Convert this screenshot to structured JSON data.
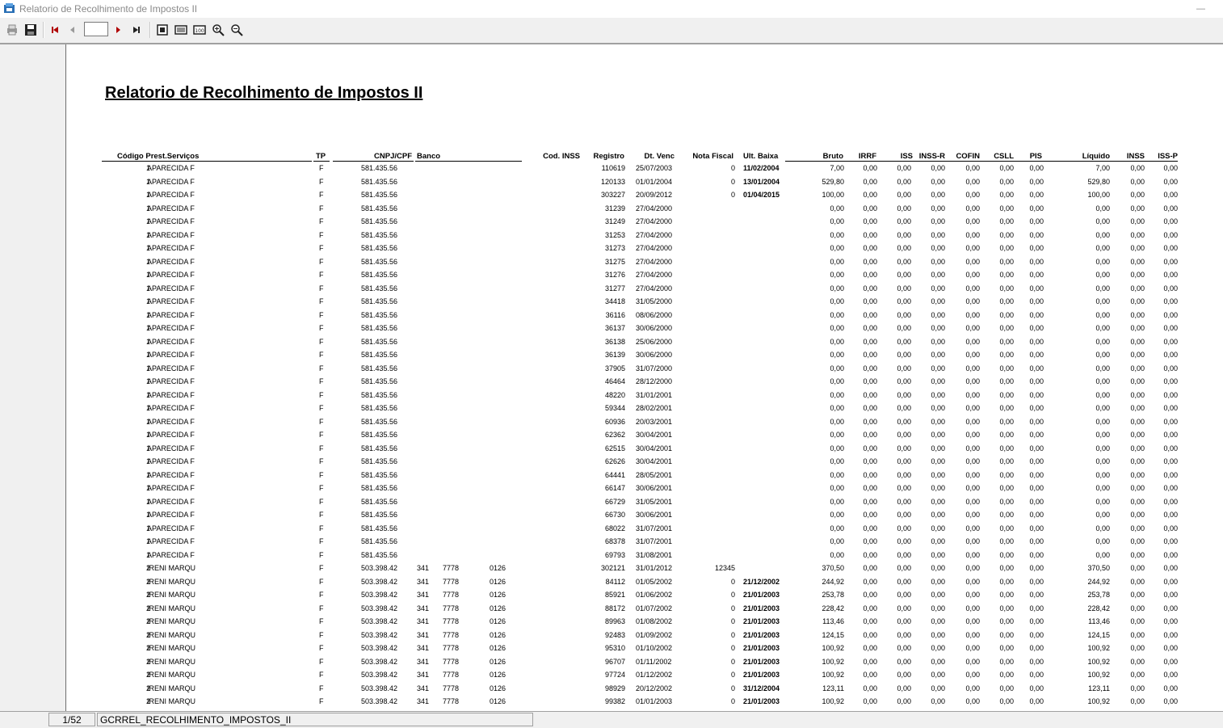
{
  "window": {
    "title": "Relatorio de Recolhimento de Impostos II",
    "minimize_glyph": "—"
  },
  "toolbar": {
    "buttons": [
      {
        "name": "print-icon"
      },
      {
        "name": "save-icon"
      },
      {
        "name": "first-page-icon"
      },
      {
        "name": "previous-page-icon"
      },
      {
        "name": "next-page-icon"
      },
      {
        "name": "last-page-icon"
      },
      {
        "name": "whole-page-icon"
      },
      {
        "name": "page-width-icon"
      },
      {
        "name": "zoom-100-icon"
      },
      {
        "name": "zoom-in-icon"
      },
      {
        "name": "zoom-out-icon"
      }
    ],
    "page_input": ""
  },
  "report": {
    "title": "Relatorio de Recolhimento de Impostos II",
    "headers": {
      "codigo": "Código Prest.Serviços",
      "tp": "TP",
      "cnpj": "CNPJ/CPF",
      "banco": "Banco",
      "cod_inss": "Cod. INSS",
      "registro": "Registro",
      "dt_venc": "Dt. Venc",
      "nota_fiscal": "Nota Fiscal",
      "ult_baixa": "Ult. Baixa",
      "bruto": "Bruto",
      "irrf": "IRRF",
      "iss": "ISS",
      "inss_r": "INSS-R",
      "cofin": "COFIN",
      "csll": "CSLL",
      "pis": "PIS",
      "liquido": "Líquido",
      "inss": "INSS",
      "iss_p": "ISS-P"
    },
    "rows": [
      {
        "cod": "1",
        "nome": "APARECIDA F",
        "tp": "F",
        "cnpj": "581.435.56",
        "banco": "",
        "ag": "",
        "conta": "",
        "registro": "110619",
        "dt_venc": "25/07/2003",
        "nf": "0",
        "ult_baixa": "11/02/2004",
        "bruto": "7,00",
        "liquido": "7,00"
      },
      {
        "cod": "1",
        "nome": "APARECIDA F",
        "tp": "F",
        "cnpj": "581.435.56",
        "banco": "",
        "ag": "",
        "conta": "",
        "registro": "120133",
        "dt_venc": "01/01/2004",
        "nf": "0",
        "ult_baixa": "13/01/2004",
        "bruto": "529,80",
        "liquido": "529,80"
      },
      {
        "cod": "1",
        "nome": "APARECIDA F",
        "tp": "F",
        "cnpj": "581.435.56",
        "banco": "",
        "ag": "",
        "conta": "",
        "registro": "303227",
        "dt_venc": "20/09/2012",
        "nf": "0",
        "ult_baixa": "01/04/2015",
        "bruto": "100,00",
        "liquido": "100,00"
      },
      {
        "cod": "1",
        "nome": "APARECIDA F",
        "tp": "F",
        "cnpj": "581.435.56",
        "banco": "",
        "ag": "",
        "conta": "",
        "registro": "31239",
        "dt_venc": "27/04/2000",
        "nf": "",
        "ult_baixa": "",
        "bruto": "0,00",
        "liquido": "0,00"
      },
      {
        "cod": "1",
        "nome": "APARECIDA F",
        "tp": "F",
        "cnpj": "581.435.56",
        "banco": "",
        "ag": "",
        "conta": "",
        "registro": "31249",
        "dt_venc": "27/04/2000",
        "nf": "",
        "ult_baixa": "",
        "bruto": "0,00",
        "liquido": "0,00"
      },
      {
        "cod": "1",
        "nome": "APARECIDA F",
        "tp": "F",
        "cnpj": "581.435.56",
        "banco": "",
        "ag": "",
        "conta": "",
        "registro": "31253",
        "dt_venc": "27/04/2000",
        "nf": "",
        "ult_baixa": "",
        "bruto": "0,00",
        "liquido": "0,00"
      },
      {
        "cod": "1",
        "nome": "APARECIDA F",
        "tp": "F",
        "cnpj": "581.435.56",
        "banco": "",
        "ag": "",
        "conta": "",
        "registro": "31273",
        "dt_venc": "27/04/2000",
        "nf": "",
        "ult_baixa": "",
        "bruto": "0,00",
        "liquido": "0,00"
      },
      {
        "cod": "1",
        "nome": "APARECIDA F",
        "tp": "F",
        "cnpj": "581.435.56",
        "banco": "",
        "ag": "",
        "conta": "",
        "registro": "31275",
        "dt_venc": "27/04/2000",
        "nf": "",
        "ult_baixa": "",
        "bruto": "0,00",
        "liquido": "0,00"
      },
      {
        "cod": "1",
        "nome": "APARECIDA F",
        "tp": "F",
        "cnpj": "581.435.56",
        "banco": "",
        "ag": "",
        "conta": "",
        "registro": "31276",
        "dt_venc": "27/04/2000",
        "nf": "",
        "ult_baixa": "",
        "bruto": "0,00",
        "liquido": "0,00"
      },
      {
        "cod": "1",
        "nome": "APARECIDA F",
        "tp": "F",
        "cnpj": "581.435.56",
        "banco": "",
        "ag": "",
        "conta": "",
        "registro": "31277",
        "dt_venc": "27/04/2000",
        "nf": "",
        "ult_baixa": "",
        "bruto": "0,00",
        "liquido": "0,00"
      },
      {
        "cod": "1",
        "nome": "APARECIDA F",
        "tp": "F",
        "cnpj": "581.435.56",
        "banco": "",
        "ag": "",
        "conta": "",
        "registro": "34418",
        "dt_venc": "31/05/2000",
        "nf": "",
        "ult_baixa": "",
        "bruto": "0,00",
        "liquido": "0,00"
      },
      {
        "cod": "1",
        "nome": "APARECIDA F",
        "tp": "F",
        "cnpj": "581.435.56",
        "banco": "",
        "ag": "",
        "conta": "",
        "registro": "36116",
        "dt_venc": "08/06/2000",
        "nf": "",
        "ult_baixa": "",
        "bruto": "0,00",
        "liquido": "0,00"
      },
      {
        "cod": "1",
        "nome": "APARECIDA F",
        "tp": "F",
        "cnpj": "581.435.56",
        "banco": "",
        "ag": "",
        "conta": "",
        "registro": "36137",
        "dt_venc": "30/06/2000",
        "nf": "",
        "ult_baixa": "",
        "bruto": "0,00",
        "liquido": "0,00"
      },
      {
        "cod": "1",
        "nome": "APARECIDA F",
        "tp": "F",
        "cnpj": "581.435.56",
        "banco": "",
        "ag": "",
        "conta": "",
        "registro": "36138",
        "dt_venc": "25/06/2000",
        "nf": "",
        "ult_baixa": "",
        "bruto": "0,00",
        "liquido": "0,00"
      },
      {
        "cod": "1",
        "nome": "APARECIDA F",
        "tp": "F",
        "cnpj": "581.435.56",
        "banco": "",
        "ag": "",
        "conta": "",
        "registro": "36139",
        "dt_venc": "30/06/2000",
        "nf": "",
        "ult_baixa": "",
        "bruto": "0,00",
        "liquido": "0,00"
      },
      {
        "cod": "1",
        "nome": "APARECIDA F",
        "tp": "F",
        "cnpj": "581.435.56",
        "banco": "",
        "ag": "",
        "conta": "",
        "registro": "37905",
        "dt_venc": "31/07/2000",
        "nf": "",
        "ult_baixa": "",
        "bruto": "0,00",
        "liquido": "0,00"
      },
      {
        "cod": "1",
        "nome": "APARECIDA F",
        "tp": "F",
        "cnpj": "581.435.56",
        "banco": "",
        "ag": "",
        "conta": "",
        "registro": "46464",
        "dt_venc": "28/12/2000",
        "nf": "",
        "ult_baixa": "",
        "bruto": "0,00",
        "liquido": "0,00"
      },
      {
        "cod": "1",
        "nome": "APARECIDA F",
        "tp": "F",
        "cnpj": "581.435.56",
        "banco": "",
        "ag": "",
        "conta": "",
        "registro": "48220",
        "dt_venc": "31/01/2001",
        "nf": "",
        "ult_baixa": "",
        "bruto": "0,00",
        "liquido": "0,00"
      },
      {
        "cod": "1",
        "nome": "APARECIDA F",
        "tp": "F",
        "cnpj": "581.435.56",
        "banco": "",
        "ag": "",
        "conta": "",
        "registro": "59344",
        "dt_venc": "28/02/2001",
        "nf": "",
        "ult_baixa": "",
        "bruto": "0,00",
        "liquido": "0,00"
      },
      {
        "cod": "1",
        "nome": "APARECIDA F",
        "tp": "F",
        "cnpj": "581.435.56",
        "banco": "",
        "ag": "",
        "conta": "",
        "registro": "60936",
        "dt_venc": "20/03/2001",
        "nf": "",
        "ult_baixa": "",
        "bruto": "0,00",
        "liquido": "0,00"
      },
      {
        "cod": "1",
        "nome": "APARECIDA F",
        "tp": "F",
        "cnpj": "581.435.56",
        "banco": "",
        "ag": "",
        "conta": "",
        "registro": "62362",
        "dt_venc": "30/04/2001",
        "nf": "",
        "ult_baixa": "",
        "bruto": "0,00",
        "liquido": "0,00"
      },
      {
        "cod": "1",
        "nome": "APARECIDA F",
        "tp": "F",
        "cnpj": "581.435.56",
        "banco": "",
        "ag": "",
        "conta": "",
        "registro": "62515",
        "dt_venc": "30/04/2001",
        "nf": "",
        "ult_baixa": "",
        "bruto": "0,00",
        "liquido": "0,00"
      },
      {
        "cod": "1",
        "nome": "APARECIDA F",
        "tp": "F",
        "cnpj": "581.435.56",
        "banco": "",
        "ag": "",
        "conta": "",
        "registro": "62626",
        "dt_venc": "30/04/2001",
        "nf": "",
        "ult_baixa": "",
        "bruto": "0,00",
        "liquido": "0,00"
      },
      {
        "cod": "1",
        "nome": "APARECIDA F",
        "tp": "F",
        "cnpj": "581.435.56",
        "banco": "",
        "ag": "",
        "conta": "",
        "registro": "64441",
        "dt_venc": "28/05/2001",
        "nf": "",
        "ult_baixa": "",
        "bruto": "0,00",
        "liquido": "0,00"
      },
      {
        "cod": "1",
        "nome": "APARECIDA F",
        "tp": "F",
        "cnpj": "581.435.56",
        "banco": "",
        "ag": "",
        "conta": "",
        "registro": "66147",
        "dt_venc": "30/06/2001",
        "nf": "",
        "ult_baixa": "",
        "bruto": "0,00",
        "liquido": "0,00"
      },
      {
        "cod": "1",
        "nome": "APARECIDA F",
        "tp": "F",
        "cnpj": "581.435.56",
        "banco": "",
        "ag": "",
        "conta": "",
        "registro": "66729",
        "dt_venc": "31/05/2001",
        "nf": "",
        "ult_baixa": "",
        "bruto": "0,00",
        "liquido": "0,00"
      },
      {
        "cod": "1",
        "nome": "APARECIDA F",
        "tp": "F",
        "cnpj": "581.435.56",
        "banco": "",
        "ag": "",
        "conta": "",
        "registro": "66730",
        "dt_venc": "30/06/2001",
        "nf": "",
        "ult_baixa": "",
        "bruto": "0,00",
        "liquido": "0,00"
      },
      {
        "cod": "1",
        "nome": "APARECIDA F",
        "tp": "F",
        "cnpj": "581.435.56",
        "banco": "",
        "ag": "",
        "conta": "",
        "registro": "68022",
        "dt_venc": "31/07/2001",
        "nf": "",
        "ult_baixa": "",
        "bruto": "0,00",
        "liquido": "0,00"
      },
      {
        "cod": "1",
        "nome": "APARECIDA F",
        "tp": "F",
        "cnpj": "581.435.56",
        "banco": "",
        "ag": "",
        "conta": "",
        "registro": "68378",
        "dt_venc": "31/07/2001",
        "nf": "",
        "ult_baixa": "",
        "bruto": "0,00",
        "liquido": "0,00"
      },
      {
        "cod": "1",
        "nome": "APARECIDA F",
        "tp": "F",
        "cnpj": "581.435.56",
        "banco": "",
        "ag": "",
        "conta": "",
        "registro": "69793",
        "dt_venc": "31/08/2001",
        "nf": "",
        "ult_baixa": "",
        "bruto": "0,00",
        "liquido": "0,00"
      },
      {
        "cod": "2",
        "nome": "IRENI MARQU",
        "tp": "F",
        "cnpj": "503.398.42",
        "banco": "341",
        "ag": "7778",
        "conta": "0126",
        "registro": "302121",
        "dt_venc": "31/01/2012",
        "nf": "12345",
        "ult_baixa": "",
        "bruto": "370,50",
        "liquido": "370,50"
      },
      {
        "cod": "2",
        "nome": "IRENI MARQU",
        "tp": "F",
        "cnpj": "503.398.42",
        "banco": "341",
        "ag": "7778",
        "conta": "0126",
        "registro": "84112",
        "dt_venc": "01/05/2002",
        "nf": "0",
        "ult_baixa": "21/12/2002",
        "bruto": "244,92",
        "liquido": "244,92"
      },
      {
        "cod": "2",
        "nome": "IRENI MARQU",
        "tp": "F",
        "cnpj": "503.398.42",
        "banco": "341",
        "ag": "7778",
        "conta": "0126",
        "registro": "85921",
        "dt_venc": "01/06/2002",
        "nf": "0",
        "ult_baixa": "21/01/2003",
        "bruto": "253,78",
        "liquido": "253,78"
      },
      {
        "cod": "2",
        "nome": "IRENI MARQU",
        "tp": "F",
        "cnpj": "503.398.42",
        "banco": "341",
        "ag": "7778",
        "conta": "0126",
        "registro": "88172",
        "dt_venc": "01/07/2002",
        "nf": "0",
        "ult_baixa": "21/01/2003",
        "bruto": "228,42",
        "liquido": "228,42"
      },
      {
        "cod": "2",
        "nome": "IRENI MARQU",
        "tp": "F",
        "cnpj": "503.398.42",
        "banco": "341",
        "ag": "7778",
        "conta": "0126",
        "registro": "89963",
        "dt_venc": "01/08/2002",
        "nf": "0",
        "ult_baixa": "21/01/2003",
        "bruto": "113,46",
        "liquido": "113,46"
      },
      {
        "cod": "2",
        "nome": "IRENI MARQU",
        "tp": "F",
        "cnpj": "503.398.42",
        "banco": "341",
        "ag": "7778",
        "conta": "0126",
        "registro": "92483",
        "dt_venc": "01/09/2002",
        "nf": "0",
        "ult_baixa": "21/01/2003",
        "bruto": "124,15",
        "liquido": "124,15"
      },
      {
        "cod": "2",
        "nome": "IRENI MARQU",
        "tp": "F",
        "cnpj": "503.398.42",
        "banco": "341",
        "ag": "7778",
        "conta": "0126",
        "registro": "95310",
        "dt_venc": "01/10/2002",
        "nf": "0",
        "ult_baixa": "21/01/2003",
        "bruto": "100,92",
        "liquido": "100,92"
      },
      {
        "cod": "2",
        "nome": "IRENI MARQU",
        "tp": "F",
        "cnpj": "503.398.42",
        "banco": "341",
        "ag": "7778",
        "conta": "0126",
        "registro": "96707",
        "dt_venc": "01/11/2002",
        "nf": "0",
        "ult_baixa": "21/01/2003",
        "bruto": "100,92",
        "liquido": "100,92"
      },
      {
        "cod": "2",
        "nome": "IRENI MARQU",
        "tp": "F",
        "cnpj": "503.398.42",
        "banco": "341",
        "ag": "7778",
        "conta": "0126",
        "registro": "97724",
        "dt_venc": "01/12/2002",
        "nf": "0",
        "ult_baixa": "21/01/2003",
        "bruto": "100,92",
        "liquido": "100,92"
      },
      {
        "cod": "2",
        "nome": "IRENI MARQU",
        "tp": "F",
        "cnpj": "503.398.42",
        "banco": "341",
        "ag": "7778",
        "conta": "0126",
        "registro": "98929",
        "dt_venc": "20/12/2002",
        "nf": "0",
        "ult_baixa": "31/12/2004",
        "bruto": "123,11",
        "liquido": "123,11"
      },
      {
        "cod": "2",
        "nome": "IRENI MARQU",
        "tp": "F",
        "cnpj": "503.398.42",
        "banco": "341",
        "ag": "7778",
        "conta": "0126",
        "registro": "99382",
        "dt_venc": "01/01/2003",
        "nf": "0",
        "ult_baixa": "21/01/2003",
        "bruto": "100,92",
        "liquido": "100,92"
      }
    ],
    "zero_value": "0,00"
  },
  "statusbar": {
    "page": "1/52",
    "report_name": "GCRREL_RECOLHIMENTO_IMPOSTOS_II"
  }
}
